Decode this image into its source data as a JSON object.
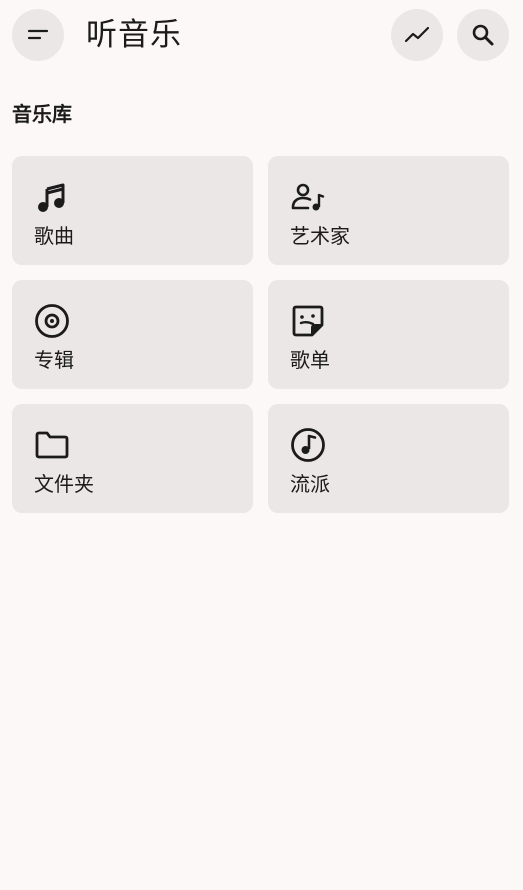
{
  "header": {
    "title": "听音乐",
    "menu_icon": "menu-icon",
    "trend_icon": "trending-icon",
    "search_icon": "search-icon"
  },
  "library": {
    "title": "音乐库",
    "items": [
      {
        "label": "歌曲",
        "icon": "music-note-icon"
      },
      {
        "label": "艺术家",
        "icon": "artist-icon"
      },
      {
        "label": "专辑",
        "icon": "album-icon"
      },
      {
        "label": "歌单",
        "icon": "playlist-icon"
      },
      {
        "label": "文件夹",
        "icon": "folder-icon"
      },
      {
        "label": "流派",
        "icon": "genre-icon"
      }
    ]
  },
  "colors": {
    "background": "#fcf8f8",
    "card": "#ebe7e7",
    "text": "#1c1b1b"
  }
}
